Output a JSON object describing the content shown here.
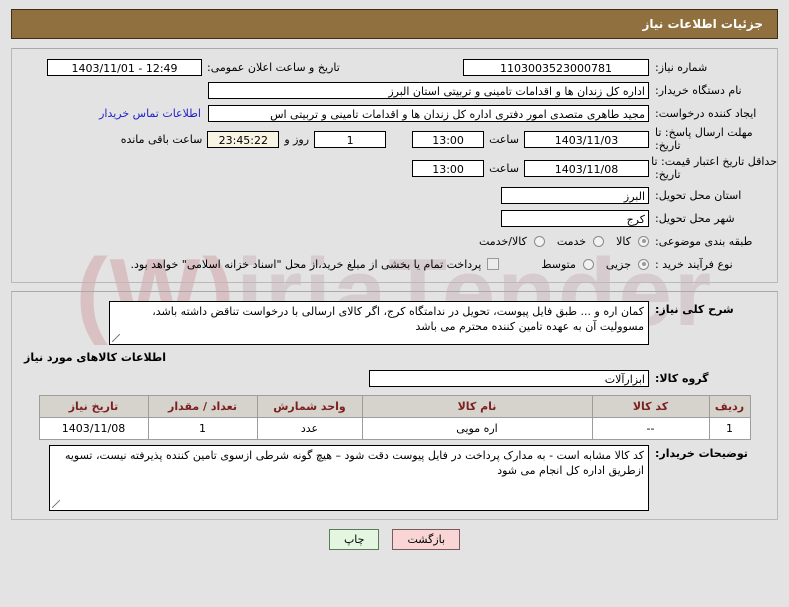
{
  "header": {
    "title": "جزئیات اطلاعات نیاز"
  },
  "watermark": {
    "text": "iriaTender",
    "mark": "(W)"
  },
  "form": {
    "need_number": {
      "label": "شماره نیاز:",
      "value": "1103003523000781"
    },
    "public_announce": {
      "label": "تاریخ و ساعت اعلان عمومی:",
      "value": "12:49 - 1403/11/01"
    },
    "buyer_org": {
      "label": "نام دستگاه خریدار:",
      "value": "اداره کل زندان ها و اقدامات تامینی و تربیتی استان البرز"
    },
    "requester": {
      "label": "ایجاد کننده درخواست:",
      "value": "مجید طاهری متصدی امور دفتری اداره کل زندان ها و اقدامات تامینی و تربیتی اس"
    },
    "contact_link": "اطلاعات تماس خریدار",
    "response_deadline": {
      "label_line1": "مهلت ارسال پاسخ: تا",
      "label_line2": "تاریخ:",
      "date": "1403/11/03",
      "time_label": "ساعت",
      "time": "13:00",
      "days_value": "1",
      "days_label": "روز و",
      "countdown": "23:45:22",
      "remaining_label": "ساعت باقی مانده"
    },
    "price_validity": {
      "label_line1": "حداقل تاریخ اعتبار قیمت: تا",
      "label_line2": "تاریخ:",
      "date": "1403/11/08",
      "time_label": "ساعت",
      "time": "13:00"
    },
    "province": {
      "label": "استان محل تحویل:",
      "value": "البرز"
    },
    "city": {
      "label": "شهر محل تحویل:",
      "value": "کرج"
    },
    "subject_class": {
      "label": "طبقه بندی موضوعی:",
      "options": [
        "کالا",
        "خدمت",
        "کالا/خدمت"
      ],
      "selected": "کالا"
    },
    "purchase_process": {
      "label": "نوع فرآیند خرید :",
      "options": [
        "جزیی",
        "متوسط"
      ],
      "selected": "جزیی"
    },
    "treasury_note": {
      "checked": false,
      "text": "پرداخت تمام یا بخشی از مبلغ خرید،از محل \"اسناد خزانه اسلامی\" خواهد بود."
    },
    "need_description": {
      "label": "شرح کلی نیاز:",
      "value": "کمان اره و ... طبق فایل پیوست، تحویل در ندامتگاه کرج، اگر کالای ارسالی با درخواست تناقض داشته باشد، مسوولیت آن به عهده تامین کننده محترم می باشد"
    }
  },
  "goods_section": {
    "title": "اطلاعات کالاهای مورد نیاز",
    "group": {
      "label": "گروه کالا:",
      "value": "ابزارآلات"
    },
    "table": {
      "columns": [
        "ردیف",
        "کد کالا",
        "نام کالا",
        "واحد شمارش",
        "تعداد / مقدار",
        "تاریخ نیاز"
      ],
      "rows": [
        {
          "radif": "1",
          "code": "--",
          "name": "اره مویی",
          "unit": "عدد",
          "qty": "1",
          "date": "1403/11/08"
        }
      ]
    },
    "buyer_notes": {
      "label": "توضیحات خریدار:",
      "value": "کد کالا مشابه است - به مدارک پرداخت در فایل پیوست دقت شود – هیچ گونه شرطی ازسوی تامین کننده پذیرفته نیست، تسویه ازطریق اداره کل انجام می شود"
    }
  },
  "footer": {
    "back_label": "بازگشت",
    "print_label": "چاپ"
  }
}
